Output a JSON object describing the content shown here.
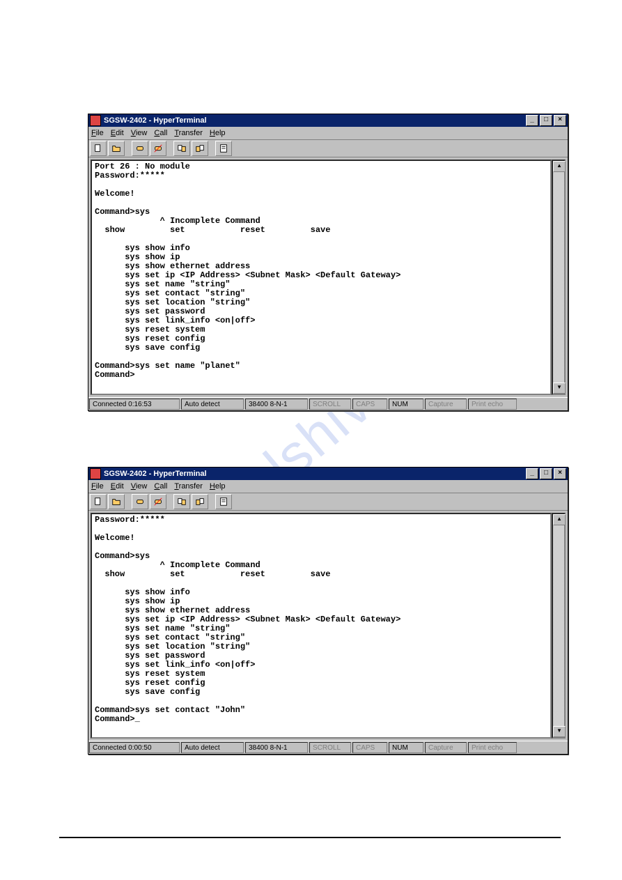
{
  "watermark": "manualshive.com",
  "window1": {
    "title": "SGSW-2402 - HyperTerminal",
    "menus": [
      "File",
      "Edit",
      "View",
      "Call",
      "Transfer",
      "Help"
    ],
    "toolbar_icons": [
      "new-file-icon",
      "open-file-icon",
      "connect-icon",
      "disconnect-icon",
      "send-icon",
      "receive-icon",
      "properties-icon"
    ],
    "terminal_text": "Port 26 : No module\nPassword:*****\n\nWelcome!\n\nCommand>sys\n             ^ Incomplete Command\n  show         set           reset         save\n\n      sys show info\n      sys show ip\n      sys show ethernet address\n      sys set ip <IP Address> <Subnet Mask> <Default Gateway>\n      sys set name \"string\"\n      sys set contact \"string\"\n      sys set location \"string\"\n      sys set password\n      sys set link_info <on|off>\n      sys reset system\n      sys reset config\n      sys save config\n\nCommand>sys set name \"planet\"\nCommand>",
    "status": {
      "connected": "Connected 0:16:53",
      "auto": "Auto detect",
      "serial": "38400 8-N-1",
      "scroll": "SCROLL",
      "caps": "CAPS",
      "num": "NUM",
      "capture": "Capture",
      "echo": "Print echo"
    }
  },
  "window2": {
    "title": "SGSW-2402 - HyperTerminal",
    "menus": [
      "File",
      "Edit",
      "View",
      "Call",
      "Transfer",
      "Help"
    ],
    "toolbar_icons": [
      "new-file-icon",
      "open-file-icon",
      "connect-icon",
      "disconnect-icon",
      "send-icon",
      "receive-icon",
      "properties-icon"
    ],
    "terminal_text": "Password:*****\n\nWelcome!\n\nCommand>sys\n             ^ Incomplete Command\n  show         set           reset         save\n\n      sys show info\n      sys show ip\n      sys show ethernet address\n      sys set ip <IP Address> <Subnet Mask> <Default Gateway>\n      sys set name \"string\"\n      sys set contact \"string\"\n      sys set location \"string\"\n      sys set password\n      sys set link_info <on|off>\n      sys reset system\n      sys reset config\n      sys save config\n\nCommand>sys set contact \"John\"\nCommand>_",
    "status": {
      "connected": "Connected 0:00:50",
      "auto": "Auto detect",
      "serial": "38400 8-N-1",
      "scroll": "SCROLL",
      "caps": "CAPS",
      "num": "NUM",
      "capture": "Capture",
      "echo": "Print echo"
    }
  }
}
